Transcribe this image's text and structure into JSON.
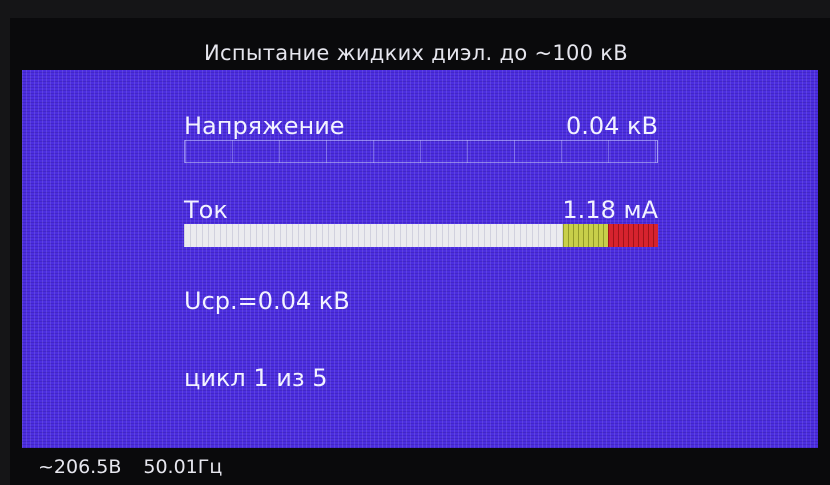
{
  "header": {
    "title": "Испытание жидких диэл. до ~100 кВ"
  },
  "voltage": {
    "label": "Напряжение",
    "value": "0.04 кВ",
    "fill_fraction": 0.0
  },
  "current": {
    "label": "Ток",
    "value": "1.18 мА",
    "fill_fraction": 1.0
  },
  "info": {
    "avg_voltage": "Uср.=0.04 кВ",
    "cycle": "цикл 1 из 5"
  },
  "status": {
    "mains_voltage": "~206.5В",
    "frequency": "50.01Гц"
  },
  "colors": {
    "panel": "#4c2ee0",
    "warn": "#c8cf4a",
    "danger": "#d7232e",
    "text": "#f2f2ff"
  }
}
